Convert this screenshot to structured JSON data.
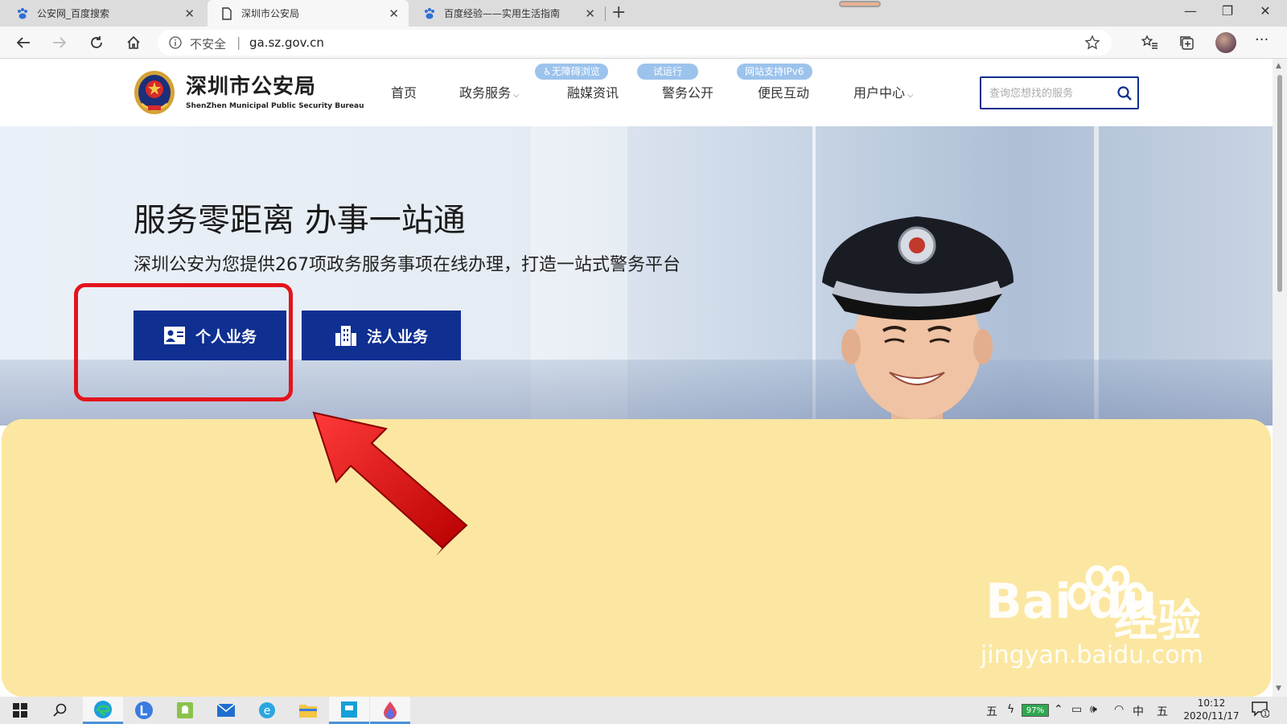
{
  "browser": {
    "tabs": [
      {
        "title": "公安网_百度搜索",
        "active": false,
        "icon": "baidu-paw-icon"
      },
      {
        "title": "深圳市公安局",
        "active": true,
        "icon": "page-icon"
      },
      {
        "title": "百度经验——实用生活指南",
        "active": false,
        "icon": "baidu-paw-icon"
      }
    ],
    "security_label": "不安全",
    "url": "ga.sz.gov.cn"
  },
  "site": {
    "name": "深圳市公安局",
    "name_en": "ShenZhen Municipal Public Security Bureau",
    "nav": [
      {
        "label": "首页",
        "dropdown": false
      },
      {
        "label": "政务服务",
        "dropdown": true
      },
      {
        "label": "融媒资讯",
        "dropdown": false
      },
      {
        "label": "警务公开",
        "dropdown": false
      },
      {
        "label": "便民互动",
        "dropdown": false
      },
      {
        "label": "用户中心",
        "dropdown": true
      }
    ],
    "pills": {
      "accessible": "♿无障碍浏览",
      "trial": "试运行",
      "ipv6": "网站支持IPv6"
    },
    "search_placeholder": "查询您想找的服务"
  },
  "hero": {
    "title": "服务零距离 办事一站通",
    "subtitle": "深圳公安为您提供267项政务服务事项在线办理，打造一站式警务平台",
    "personal_button": "个人业务",
    "corporate_button": "法人业务"
  },
  "watermark": {
    "brand": "Bai du",
    "brand_cn": "经验",
    "url": "jingyan.baidu.com"
  },
  "taskbar": {
    "battery": "97%",
    "ime_1": "五",
    "ime_lang": "中",
    "ime_2": "五",
    "time": "10:12",
    "date": "2020/11/17",
    "notifications": "1"
  },
  "colors": {
    "primary": "#0f2f91",
    "highlight": "#e3141c",
    "overlay": "#fbe7a1",
    "pill": "#9cc3ec"
  }
}
